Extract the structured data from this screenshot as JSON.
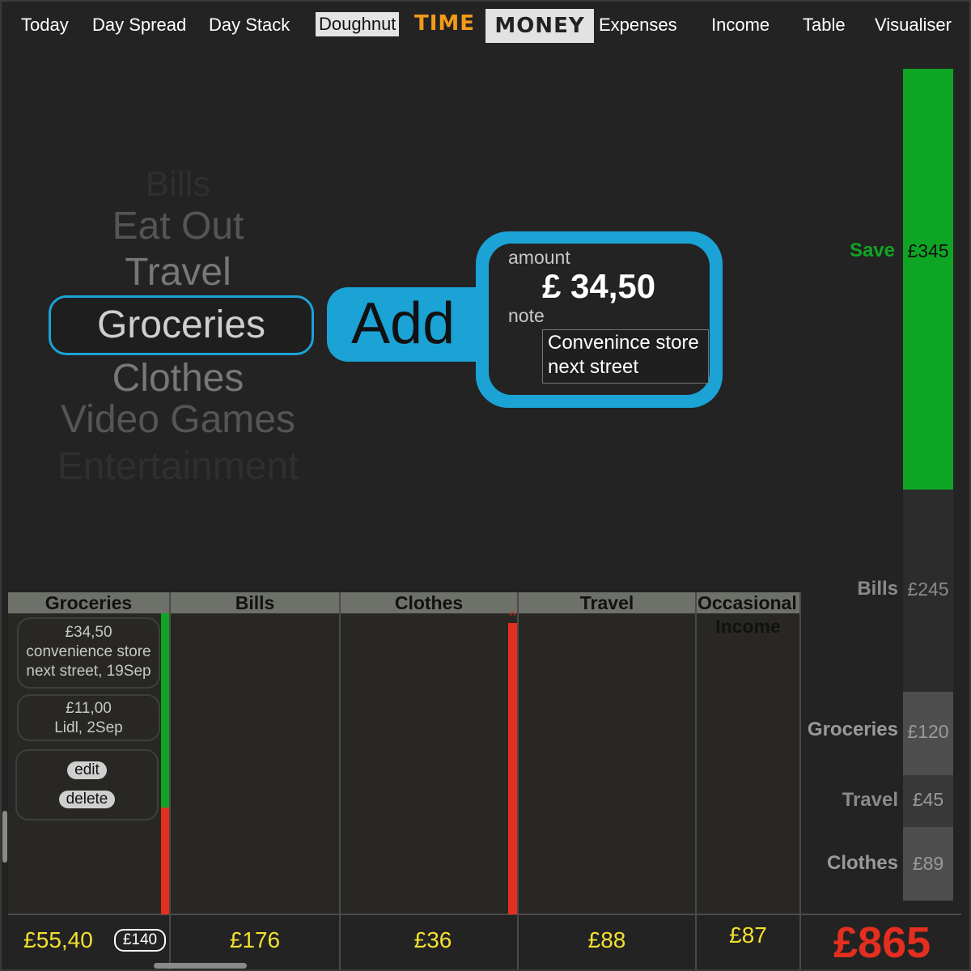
{
  "nav": {
    "today": "Today",
    "day_spread": "Day Spread",
    "day_stack": "Day Stack",
    "doughnut": "Doughnut",
    "brand_time": "TIME",
    "brand_money": "MONEY",
    "expenses": "Expenses",
    "income": "Income",
    "table": "Table",
    "visualiser": "Visualiser"
  },
  "picker": {
    "items": [
      "Bills",
      "Eat Out",
      "Travel",
      "Groceries",
      "Clothes",
      "Video Games",
      "Entertainment"
    ],
    "selected": "Groceries"
  },
  "entry": {
    "add_label": "Add",
    "amount_label": "amount",
    "amount_value": "£ 34,50",
    "note_label": "note",
    "note_value": "Convenince store\nnext street"
  },
  "budget": {
    "segments": [
      {
        "label": "Save",
        "value": "£345",
        "color": "#0fa524",
        "label_color": "#0fa524"
      },
      {
        "label": "Bills",
        "value": "£245",
        "color": "#2c2c2c",
        "label_color": "#8a8a8a"
      },
      {
        "label": "Groceries",
        "value": "£120",
        "color": "#4e4e4e",
        "label_color": "#9a9a9a"
      },
      {
        "label": "Travel",
        "value": "£45",
        "color": "#383838",
        "label_color": "#8a8a8a"
      },
      {
        "label": "Clothes",
        "value": "£89",
        "color": "#4e4e4e",
        "label_color": "#9a9a9a"
      }
    ]
  },
  "columns": {
    "headers": [
      "Groceries",
      "Bills",
      "Clothes",
      "Travel",
      "Occasional",
      "Income"
    ],
    "groceries_cards": [
      {
        "amount": "£34,50",
        "line1": "convenience store",
        "line2": "next street, 19Sep"
      },
      {
        "amount": "£11,00",
        "line1": "Lidl, 2Sep",
        "line2": ""
      }
    ],
    "edit_label": "edit",
    "delete_label": "delete",
    "up_marker": "^"
  },
  "totals": {
    "groceries": "£55,40",
    "groceries_budget": "£140",
    "bills": "£176",
    "clothes": "£36",
    "travel": "£88",
    "occasional": "£87",
    "grand_total": "£865"
  },
  "colors": {
    "accent": "#1ba3d6",
    "save_green": "#0fa524",
    "over_red": "#e42e1f",
    "total_yellow": "#f3e12f",
    "brand_orange": "#f39a1a"
  }
}
